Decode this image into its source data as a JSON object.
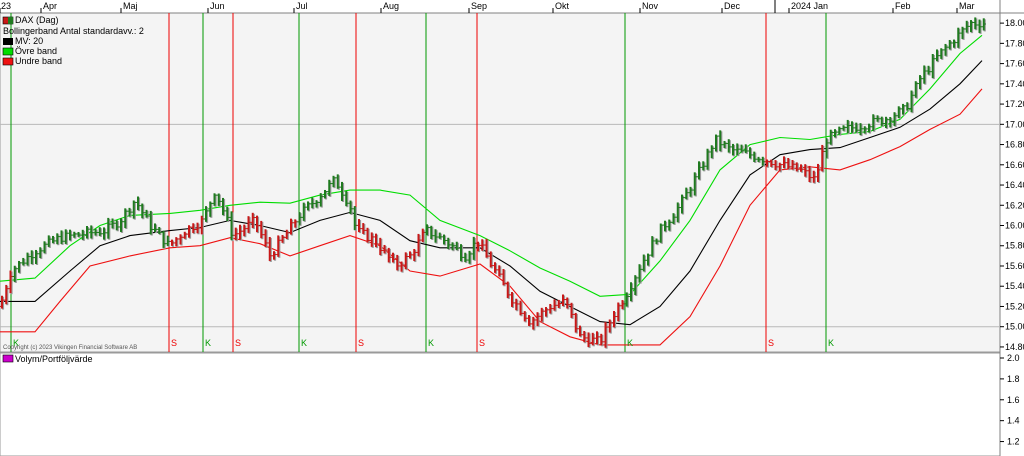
{
  "chart_data": [
    {
      "type": "ohlc",
      "legend": [
        "DAX (Dag)",
        "Bollingerband  Antal standardavv.: 2",
        "MV: 20",
        "Övre band",
        "Undre band"
      ],
      "months": [
        "23",
        "Apr",
        "Maj",
        "Jun",
        "Jul",
        "Aug",
        "Sep",
        "Okt",
        "Nov",
        "Dec",
        "2024 Jan",
        "Feb",
        "Mar"
      ],
      "y_ticks": [
        "18.00'",
        "17.80'",
        "17.60'",
        "17.40'",
        "17.20'",
        "17.00'",
        "16.80'",
        "16.60'",
        "16.40'",
        "16.20'",
        "16.00'",
        "15.80'",
        "15.60'",
        "15.40'",
        "15.20'",
        "15.00'",
        "14.80'"
      ],
      "ylim": [
        14.75,
        18.1
      ],
      "unit": "thousands",
      "copyright": "Copyright (c) 2023 Vikingen Financial Software AB",
      "signals": [
        {
          "x": 0.011,
          "label": "K"
        },
        {
          "x": 0.169,
          "label": "S"
        },
        {
          "x": 0.203,
          "label": "K"
        },
        {
          "x": 0.233,
          "label": "S"
        },
        {
          "x": 0.299,
          "label": "K"
        },
        {
          "x": 0.356,
          "label": "S"
        },
        {
          "x": 0.426,
          "label": "K"
        },
        {
          "x": 0.477,
          "label": "S"
        },
        {
          "x": 0.625,
          "label": "K"
        },
        {
          "x": 0.766,
          "label": "S"
        },
        {
          "x": 0.826,
          "label": "K"
        }
      ],
      "price_path": [
        [
          0.0,
          15.2
        ],
        [
          0.011,
          15.55
        ],
        [
          0.035,
          15.75
        ],
        [
          0.06,
          15.88
        ],
        [
          0.085,
          15.92
        ],
        [
          0.105,
          15.95
        ],
        [
          0.12,
          16.05
        ],
        [
          0.135,
          16.25
        ],
        [
          0.15,
          16.0
        ],
        [
          0.169,
          15.8
        ],
        [
          0.185,
          15.95
        ],
        [
          0.203,
          16.05
        ],
        [
          0.215,
          16.35
        ],
        [
          0.233,
          15.9
        ],
        [
          0.255,
          16.05
        ],
        [
          0.27,
          15.7
        ],
        [
          0.285,
          15.9
        ],
        [
          0.299,
          16.1
        ],
        [
          0.315,
          16.25
        ],
        [
          0.335,
          16.45
        ],
        [
          0.35,
          16.2
        ],
        [
          0.356,
          15.95
        ],
        [
          0.375,
          15.85
        ],
        [
          0.395,
          15.6
        ],
        [
          0.41,
          15.7
        ],
        [
          0.426,
          15.95
        ],
        [
          0.445,
          15.85
        ],
        [
          0.465,
          15.7
        ],
        [
          0.477,
          15.85
        ],
        [
          0.495,
          15.55
        ],
        [
          0.51,
          15.3
        ],
        [
          0.53,
          15.05
        ],
        [
          0.55,
          15.2
        ],
        [
          0.565,
          15.25
        ],
        [
          0.58,
          14.9
        ],
        [
          0.6,
          14.85
        ],
        [
          0.615,
          15.15
        ],
        [
          0.625,
          15.3
        ],
        [
          0.64,
          15.6
        ],
        [
          0.66,
          15.95
        ],
        [
          0.68,
          16.2
        ],
        [
          0.7,
          16.55
        ],
        [
          0.715,
          16.85
        ],
        [
          0.73,
          16.75
        ],
        [
          0.75,
          16.7
        ],
        [
          0.766,
          16.65
        ],
        [
          0.78,
          16.6
        ],
        [
          0.8,
          16.55
        ],
        [
          0.815,
          16.45
        ],
        [
          0.826,
          16.85
        ],
        [
          0.845,
          16.95
        ],
        [
          0.865,
          17.0
        ],
        [
          0.885,
          17.05
        ],
        [
          0.905,
          17.15
        ],
        [
          0.92,
          17.45
        ],
        [
          0.94,
          17.7
        ],
        [
          0.955,
          17.85
        ],
        [
          0.97,
          18.0
        ]
      ],
      "mv_path": [
        [
          0.0,
          15.25
        ],
        [
          0.035,
          15.25
        ],
        [
          0.07,
          15.55
        ],
        [
          0.1,
          15.8
        ],
        [
          0.13,
          15.9
        ],
        [
          0.17,
          15.95
        ],
        [
          0.2,
          15.98
        ],
        [
          0.23,
          16.05
        ],
        [
          0.26,
          16.0
        ],
        [
          0.29,
          15.93
        ],
        [
          0.32,
          16.05
        ],
        [
          0.35,
          16.13
        ],
        [
          0.38,
          16.05
        ],
        [
          0.41,
          15.85
        ],
        [
          0.44,
          15.78
        ],
        [
          0.48,
          15.78
        ],
        [
          0.51,
          15.6
        ],
        [
          0.54,
          15.35
        ],
        [
          0.57,
          15.2
        ],
        [
          0.6,
          15.05
        ],
        [
          0.63,
          15.02
        ],
        [
          0.66,
          15.2
        ],
        [
          0.69,
          15.55
        ],
        [
          0.72,
          16.05
        ],
        [
          0.75,
          16.5
        ],
        [
          0.78,
          16.7
        ],
        [
          0.81,
          16.75
        ],
        [
          0.84,
          16.77
        ],
        [
          0.87,
          16.87
        ],
        [
          0.9,
          16.97
        ],
        [
          0.93,
          17.15
        ],
        [
          0.96,
          17.4
        ],
        [
          0.982,
          17.63
        ]
      ],
      "upper_path": [
        [
          0.0,
          15.45
        ],
        [
          0.035,
          15.48
        ],
        [
          0.07,
          15.8
        ],
        [
          0.1,
          16.0
        ],
        [
          0.13,
          16.1
        ],
        [
          0.17,
          16.12
        ],
        [
          0.2,
          16.15
        ],
        [
          0.23,
          16.2
        ],
        [
          0.26,
          16.23
        ],
        [
          0.29,
          16.22
        ],
        [
          0.32,
          16.3
        ],
        [
          0.35,
          16.35
        ],
        [
          0.38,
          16.35
        ],
        [
          0.41,
          16.3
        ],
        [
          0.44,
          16.05
        ],
        [
          0.48,
          15.9
        ],
        [
          0.51,
          15.75
        ],
        [
          0.54,
          15.58
        ],
        [
          0.57,
          15.45
        ],
        [
          0.6,
          15.3
        ],
        [
          0.63,
          15.32
        ],
        [
          0.66,
          15.65
        ],
        [
          0.69,
          16.05
        ],
        [
          0.72,
          16.55
        ],
        [
          0.75,
          16.8
        ],
        [
          0.78,
          16.87
        ],
        [
          0.81,
          16.85
        ],
        [
          0.84,
          16.9
        ],
        [
          0.87,
          16.93
        ],
        [
          0.9,
          17.05
        ],
        [
          0.93,
          17.35
        ],
        [
          0.96,
          17.7
        ],
        [
          0.982,
          17.88
        ]
      ],
      "lower_path": [
        [
          0.0,
          14.95
        ],
        [
          0.035,
          14.95
        ],
        [
          0.06,
          15.25
        ],
        [
          0.09,
          15.6
        ],
        [
          0.13,
          15.7
        ],
        [
          0.17,
          15.78
        ],
        [
          0.2,
          15.8
        ],
        [
          0.23,
          15.88
        ],
        [
          0.26,
          15.82
        ],
        [
          0.29,
          15.7
        ],
        [
          0.32,
          15.8
        ],
        [
          0.35,
          15.9
        ],
        [
          0.38,
          15.8
        ],
        [
          0.41,
          15.55
        ],
        [
          0.44,
          15.5
        ],
        [
          0.48,
          15.62
        ],
        [
          0.51,
          15.4
        ],
        [
          0.54,
          15.05
        ],
        [
          0.57,
          14.9
        ],
        [
          0.6,
          14.82
        ],
        [
          0.63,
          14.82
        ],
        [
          0.66,
          14.82
        ],
        [
          0.69,
          15.1
        ],
        [
          0.72,
          15.6
        ],
        [
          0.75,
          16.2
        ],
        [
          0.78,
          16.55
        ],
        [
          0.81,
          16.58
        ],
        [
          0.84,
          16.55
        ],
        [
          0.87,
          16.65
        ],
        [
          0.9,
          16.78
        ],
        [
          0.93,
          16.95
        ],
        [
          0.96,
          17.1
        ],
        [
          0.982,
          17.35
        ]
      ]
    },
    {
      "type": "line",
      "legend": [
        "Volym/Portföljvärde"
      ],
      "y_ticks": [
        "2.0",
        "1.8",
        "1.6",
        "1.4",
        "1.2"
      ],
      "ylim": [
        1.1,
        2.0
      ]
    }
  ],
  "colors": {
    "up": "#1f7a1f",
    "down": "#c81818",
    "mv": "#000000",
    "upper": "#00dd00",
    "lower": "#ee1111",
    "buy": "#009900",
    "sell": "#ee0000",
    "legend_volume": "#cc00cc"
  }
}
